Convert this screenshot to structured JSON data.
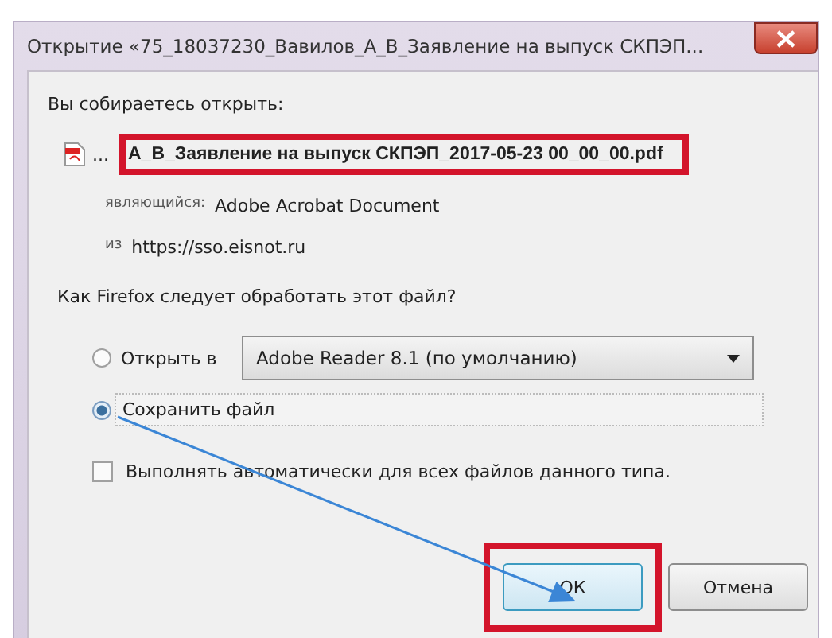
{
  "window": {
    "title": "Открытие «75_18037230_Вавилов_А_В_Заявление на выпуск СКПЭП..."
  },
  "intro": "Вы собираетесь открыть:",
  "file": {
    "ellipsis": "...",
    "name": "А_В_Заявление на выпуск СКПЭП_2017-05-23 00_00_00.pdf",
    "highlighted": true
  },
  "details": [
    {
      "label": "являющийся:",
      "value": "Adobe Acrobat Document"
    },
    {
      "label": "из",
      "value": "https://sso.eisnot.ru"
    }
  ],
  "question": "Как Firefox следует обработать этот файл?",
  "options": [
    {
      "kind": "open-with",
      "label": "Открыть в",
      "selected": false,
      "app": "Adobe Reader 8.1 (по умолчанию)"
    },
    {
      "kind": "save",
      "label": "Сохранить файл",
      "selected": true
    }
  ],
  "auto": {
    "label": "Выполнять автоматически для всех файлов данного типа.",
    "checked": false
  },
  "buttons": [
    {
      "label": "ОК",
      "highlighted": true
    },
    {
      "label": "Отмена",
      "highlighted": false
    }
  ]
}
